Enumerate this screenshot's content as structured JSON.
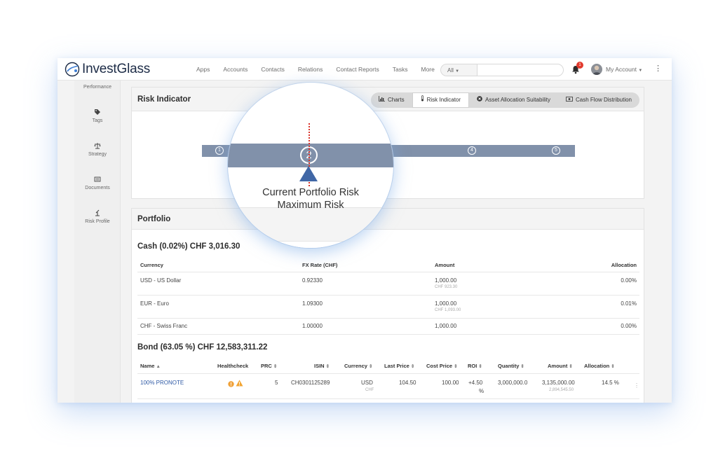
{
  "app": {
    "name": "InvestGlass"
  },
  "nav": [
    "Apps",
    "Accounts",
    "Contacts",
    "Relations",
    "Contact Reports",
    "Tasks",
    "More"
  ],
  "search": {
    "scope": "All",
    "placeholder": ""
  },
  "notifications": {
    "count": "1"
  },
  "account": {
    "label": "My Account"
  },
  "sidebar": [
    {
      "label": "Performance",
      "icon": "performance-icon"
    },
    {
      "label": "Tags",
      "icon": "tag-icon"
    },
    {
      "label": "Strategy",
      "icon": "scale-icon"
    },
    {
      "label": "Documents",
      "icon": "documents-icon"
    },
    {
      "label": "Risk Profile",
      "icon": "risk-profile-icon"
    }
  ],
  "risk_indicator": {
    "title": "Risk Indicator",
    "tabs": [
      {
        "label": "Charts",
        "icon": "chart-icon"
      },
      {
        "label": "Risk Indicator",
        "icon": "thermometer-icon",
        "active": true
      },
      {
        "label": "Asset Allocation Suitability",
        "icon": "close-circle-icon"
      },
      {
        "label": "Cash Flow Distribution",
        "icon": "cash-icon"
      }
    ],
    "levels": [
      "1",
      "2",
      "3",
      "4",
      "5"
    ],
    "current_level": 2,
    "magnified": {
      "level": "2",
      "line1": "Current Portfolio Risk",
      "line2": "Maximum Risk"
    }
  },
  "portfolio": {
    "title": "Portfolio",
    "cash": {
      "title": "Cash (0.02%) CHF 3,016.30",
      "headers": {
        "currency": "Currency",
        "fx": "FX Rate (CHF)",
        "amount": "Amount",
        "allocation": "Allocation"
      },
      "rows": [
        {
          "currency": "USD - US Dollar",
          "fx": "0.92330",
          "amount": "1,000.00",
          "amount_sub": "CHF 923.30",
          "allocation": "0.00%"
        },
        {
          "currency": "EUR - Euro",
          "fx": "1.09300",
          "amount": "1,000.00",
          "amount_sub": "CHF 1,093.00",
          "allocation": "0.01%"
        },
        {
          "currency": "CHF - Swiss Franc",
          "fx": "1.00000",
          "amount": "1,000.00",
          "amount_sub": "",
          "allocation": "0.00%"
        }
      ]
    },
    "bond": {
      "title": "Bond (63.05 %) CHF 12,583,311.22",
      "headers": {
        "name": "Name",
        "healthcheck": "Healthcheck",
        "prc": "PRC",
        "isin": "ISIN",
        "currency": "Currency",
        "last_price": "Last Price",
        "cost_price": "Cost Price",
        "roi": "ROI",
        "quantity": "Quantity",
        "amount": "Amount",
        "allocation": "Allocation"
      },
      "rows": [
        {
          "name": "100% PRONOTE",
          "prc": "5",
          "isin": "CH0301125289",
          "currency": "USD",
          "currency_sub": "CHF",
          "last_price": "104.50",
          "cost_price": "100.00",
          "roi": "+4.50",
          "roi_unit": "%",
          "quantity": "3,000,000.0",
          "amount": "3,135,000.00",
          "amount_sub": "2,894,545.50",
          "allocation": "14.5 %"
        }
      ]
    }
  },
  "colors": {
    "risk_bar": "#8191aa",
    "marker": "#4067a6",
    "marker_line": "#d9342b",
    "link": "#2f5aa5"
  }
}
